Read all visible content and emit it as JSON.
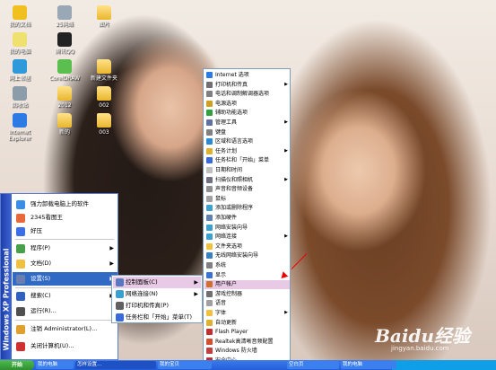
{
  "desktop_icons": [
    {
      "label": "我的文档",
      "color": "#f0c020"
    },
    {
      "label": "25网络",
      "color": "#9aa7b5"
    },
    {
      "label": "图片",
      "color": "folder"
    },
    {
      "label": "我的电脑",
      "color": "#f0e070"
    },
    {
      "label": "腾讯QQ",
      "color": "#222222"
    },
    {
      "label": "",
      "color": "blank"
    },
    {
      "label": "网上邻居",
      "color": "#2f9ad9"
    },
    {
      "label": "CorelDRAW",
      "color": "#5bbf4f"
    },
    {
      "label": "新建文件夹",
      "color": "folder"
    },
    {
      "label": "回收站",
      "color": "#8c9ca8"
    },
    {
      "label": "2012",
      "color": "folder"
    },
    {
      "label": "002",
      "color": "folder"
    },
    {
      "label": "Internet Explorer",
      "color": "#2c7be5"
    },
    {
      "label": "新的",
      "color": "folder"
    },
    {
      "label": "003",
      "color": "folder"
    }
  ],
  "start_menu": {
    "band_text": "Windows XP Professional",
    "items": [
      {
        "label": "强力卸载电脑上的软件",
        "color": "#3b8ee8",
        "arrow": ""
      },
      {
        "label": "2345看图王",
        "color": "#e8683b",
        "arrow": ""
      },
      {
        "label": "好压",
        "color": "#3b6ee8",
        "arrow": ""
      },
      {
        "label": "程序(P)",
        "color": "#48a04a",
        "arrow": "▶"
      },
      {
        "label": "文档(D)",
        "color": "#f0c040",
        "arrow": "▶"
      },
      {
        "label": "设置(S)",
        "color": "#6a7fb0",
        "arrow": "▶"
      },
      {
        "label": "搜索(C)",
        "color": "#3060c0",
        "arrow": "▶"
      },
      {
        "label": "运行(R)...",
        "color": "#505050",
        "arrow": ""
      },
      {
        "label": "注销 Administrator(L)...",
        "color": "#e0a030",
        "arrow": ""
      },
      {
        "label": "关闭计算机(U)...",
        "color": "#d03030",
        "arrow": ""
      }
    ]
  },
  "settings_submenu": [
    {
      "label": "控制面板(C)",
      "color": "#5a78c0",
      "arrow": "▶"
    },
    {
      "label": "网络连接(N)",
      "color": "#3aa0d0",
      "arrow": "▶"
    },
    {
      "label": "打印机和传真(P)",
      "color": "#606060",
      "arrow": ""
    },
    {
      "label": "任务栏和「开始」菜单(T)",
      "color": "#3a6ad8",
      "arrow": ""
    }
  ],
  "control_panel_menu": [
    {
      "label": "Internet 选项",
      "color": "#2c7be5",
      "arrow": ""
    },
    {
      "label": "打印机和传真",
      "color": "#707070",
      "arrow": "▶"
    },
    {
      "label": "电话和调制解调器选项",
      "color": "#808080",
      "arrow": ""
    },
    {
      "label": "电源选项",
      "color": "#d0a020",
      "arrow": ""
    },
    {
      "label": "辅助功能选项",
      "color": "#30a040",
      "arrow": ""
    },
    {
      "label": "管理工具",
      "color": "#6070a0",
      "arrow": "▶"
    },
    {
      "label": "键盘",
      "color": "#808080",
      "arrow": ""
    },
    {
      "label": "区域和语言选项",
      "color": "#2c8ad5",
      "arrow": ""
    },
    {
      "label": "任务计划",
      "color": "#e0b030",
      "arrow": "▶"
    },
    {
      "label": "任务栏和「开始」菜单",
      "color": "#3a6ad8",
      "arrow": ""
    },
    {
      "label": "日期和时间",
      "color": "#c0c0c0",
      "arrow": ""
    },
    {
      "label": "扫描仪和照相机",
      "color": "#707080",
      "arrow": "▶"
    },
    {
      "label": "声音和音频设备",
      "color": "#909090",
      "arrow": ""
    },
    {
      "label": "鼠标",
      "color": "#a0a0a0",
      "arrow": ""
    },
    {
      "label": "添加或删除程序",
      "color": "#40a0d0",
      "arrow": ""
    },
    {
      "label": "添加硬件",
      "color": "#6080b0",
      "arrow": ""
    },
    {
      "label": "网络安装向导",
      "color": "#3aa0d0",
      "arrow": ""
    },
    {
      "label": "网络连接",
      "color": "#3aa0d0",
      "arrow": "▶"
    },
    {
      "label": "文件夹选项",
      "color": "#f0c040",
      "arrow": ""
    },
    {
      "label": "无线网络安装向导",
      "color": "#3a80c0",
      "arrow": ""
    },
    {
      "label": "系统",
      "color": "#808080",
      "arrow": ""
    },
    {
      "label": "显示",
      "color": "#3a70d0",
      "arrow": ""
    },
    {
      "label": "用户帐户",
      "color": "#d07030",
      "arrow": ""
    },
    {
      "label": "游戏控制器",
      "color": "#707070",
      "arrow": ""
    },
    {
      "label": "语音",
      "color": "#a0a0a0",
      "arrow": ""
    },
    {
      "label": "字体",
      "color": "#f0c040",
      "arrow": "▶"
    },
    {
      "label": "自动更新",
      "color": "#e0b030",
      "arrow": ""
    },
    {
      "label": "Flash Player",
      "color": "#c03030",
      "arrow": ""
    },
    {
      "label": "Realtek高清晰音频配置",
      "color": "#d05030",
      "arrow": ""
    },
    {
      "label": "Windows 防火墙",
      "color": "#c04040",
      "arrow": ""
    },
    {
      "label": "安全中心",
      "color": "#c03030",
      "arrow": ""
    }
  ],
  "taskbar": {
    "start_label": "开始",
    "buttons": [
      {
        "label": "我的电脑",
        "active": false
      },
      {
        "label": "怎样设置...",
        "active": true
      },
      {
        "label": "我的宝贝",
        "active": false
      },
      {
        "label": "空白页",
        "active": false
      },
      {
        "label": "我的电脑",
        "active": false
      }
    ]
  },
  "watermark": {
    "main": "Baidu经验",
    "sub": "jingyan.baidu.com"
  }
}
